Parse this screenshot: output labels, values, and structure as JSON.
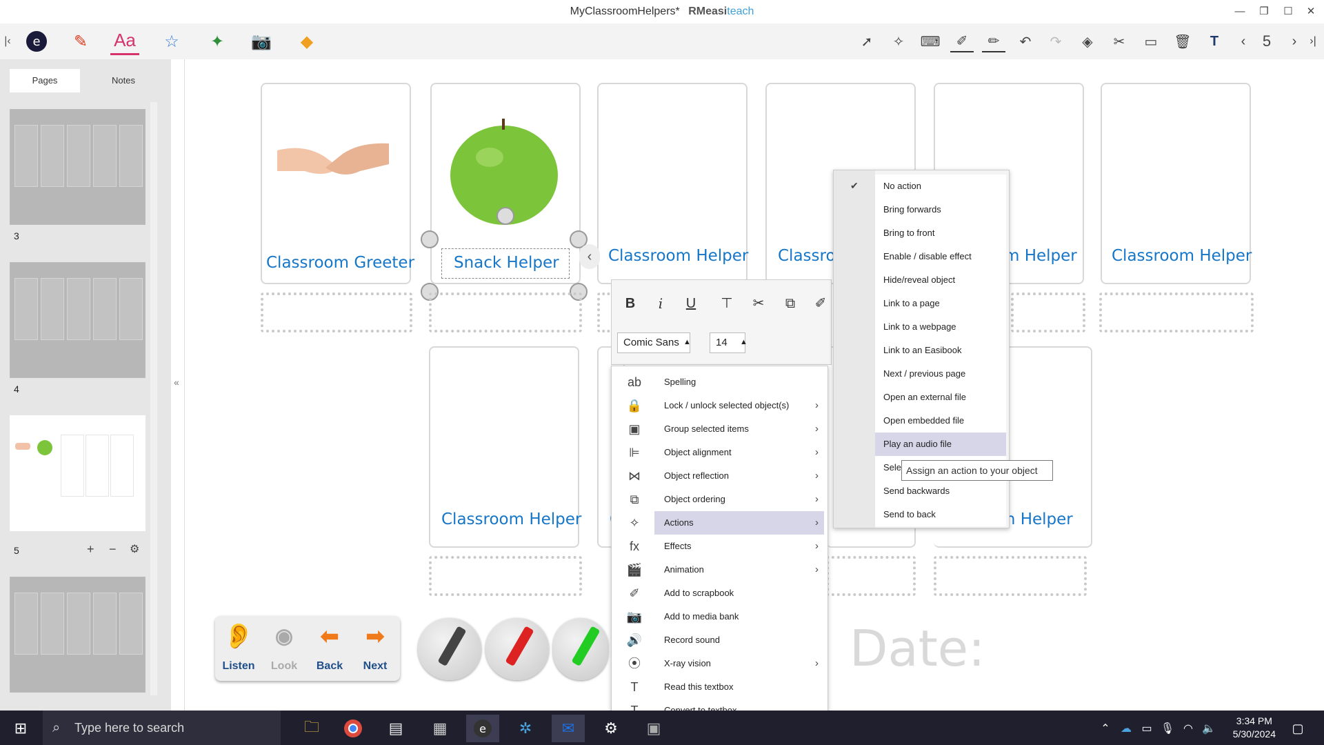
{
  "window": {
    "title": "MyClassroomHelpers*",
    "brand_prefix": "RM",
    "brand_mid": "easi",
    "brand_suffix": "teach",
    "minimize_icon": "minimize-icon",
    "restore_icon": "restore-icon",
    "maximize_icon": "maximize-icon",
    "close_icon": "close-icon"
  },
  "toolbar": {
    "page_number": "5",
    "tools": [
      "easiteach-menu-icon",
      "pen-icon",
      "text-icon",
      "star-icon",
      "interactive-icon",
      "camera-icon",
      "media-icon"
    ],
    "right_tools": [
      "select-icon",
      "magic-select-icon",
      "keyboard-icon",
      "highlighter-icon",
      "pen-icon",
      "undo-icon",
      "redo-icon",
      "eraser-icon",
      "clear-icon",
      "display-icon",
      "delete-icon",
      "text-tool-icon",
      "previous-page-icon",
      "next-page-icon"
    ]
  },
  "left_panel": {
    "tabs": [
      "Pages",
      "Notes"
    ],
    "pages": [
      {
        "number": "3"
      },
      {
        "number": "4"
      },
      {
        "number": "5"
      },
      {
        "number": ""
      }
    ],
    "page_controls": {
      "add": "+",
      "remove": "−",
      "settings": "⚙"
    }
  },
  "canvas": {
    "cards_top": [
      {
        "label": "Classroom Greeter",
        "image": "handshake-image"
      },
      {
        "label": "Snack Helper",
        "image": "apple-image"
      },
      {
        "label": "Classroom Helper"
      },
      {
        "label": "Classro"
      },
      {
        "label": "m Helper"
      },
      {
        "label": "Classroom Helper"
      }
    ],
    "cards_bottom": [
      {
        "label": "Classroom Helper"
      },
      {
        "label": "C"
      },
      {
        "label": "o"
      },
      {
        "label": "m Helper"
      }
    ],
    "date_label": "Date:"
  },
  "nav_widget": {
    "listen": "Listen",
    "look": "Look",
    "back": "Back",
    "next": "Next"
  },
  "format_toolbar": {
    "bold": "B",
    "italic": "i",
    "underline": "U",
    "font_name": "Comic Sans M",
    "font_size": "14"
  },
  "context_menu": {
    "items": [
      {
        "label": "Spelling",
        "icon": "spelling-icon",
        "submenu": false
      },
      {
        "label": "Lock / unlock selected object(s)",
        "icon": "lock-icon",
        "submenu": true
      },
      {
        "label": "Group selected items",
        "icon": "group-icon",
        "submenu": true
      },
      {
        "label": "Object alignment",
        "icon": "alignment-icon",
        "submenu": true
      },
      {
        "label": "Object reflection",
        "icon": "reflection-icon",
        "submenu": true
      },
      {
        "label": "Object ordering",
        "icon": "ordering-icon",
        "submenu": true
      },
      {
        "label": "Actions",
        "icon": "actions-icon",
        "submenu": true,
        "highlighted": true
      },
      {
        "label": "Effects",
        "icon": "fx-icon",
        "submenu": true
      },
      {
        "label": "Animation",
        "icon": "animation-icon",
        "submenu": true
      },
      {
        "label": "Add to scrapbook",
        "icon": "scrapbook-icon",
        "submenu": false
      },
      {
        "label": "Add to media bank",
        "icon": "media-bank-icon",
        "submenu": false
      },
      {
        "label": "Record sound",
        "icon": "record-sound-icon",
        "submenu": false
      },
      {
        "label": "X-ray vision",
        "icon": "xray-icon",
        "submenu": true
      },
      {
        "label": "Read this textbox",
        "icon": "read-textbox-icon",
        "submenu": false
      },
      {
        "label": "Convert to textbox",
        "icon": "convert-textbox-icon",
        "submenu": false
      }
    ]
  },
  "actions_submenu": {
    "items": [
      {
        "label": "No action",
        "checked": true
      },
      {
        "label": "Bring forwards"
      },
      {
        "label": "Bring to front"
      },
      {
        "label": "Enable / disable effect"
      },
      {
        "label": "Hide/reveal object"
      },
      {
        "label": "Link to a page"
      },
      {
        "label": "Link to a webpage"
      },
      {
        "label": "Link to an Easibook"
      },
      {
        "label": "Next / previous page"
      },
      {
        "label": "Open an external file"
      },
      {
        "label": "Open embedded file"
      },
      {
        "label": "Play an audio file",
        "highlighted": true
      },
      {
        "label": "Sele"
      },
      {
        "label": "Send backwards"
      },
      {
        "label": "Send to back"
      }
    ],
    "tooltip": "Assign an action to your object"
  },
  "taskbar": {
    "search_placeholder": "Type here to search",
    "time": "3:34 PM",
    "date": "5/30/2024"
  },
  "colors": {
    "accent_pink": "#d6336c",
    "label_blue": "#1676c8",
    "taskbar": "#1f1f2e",
    "menu_highlight": "#d6d6e8"
  }
}
